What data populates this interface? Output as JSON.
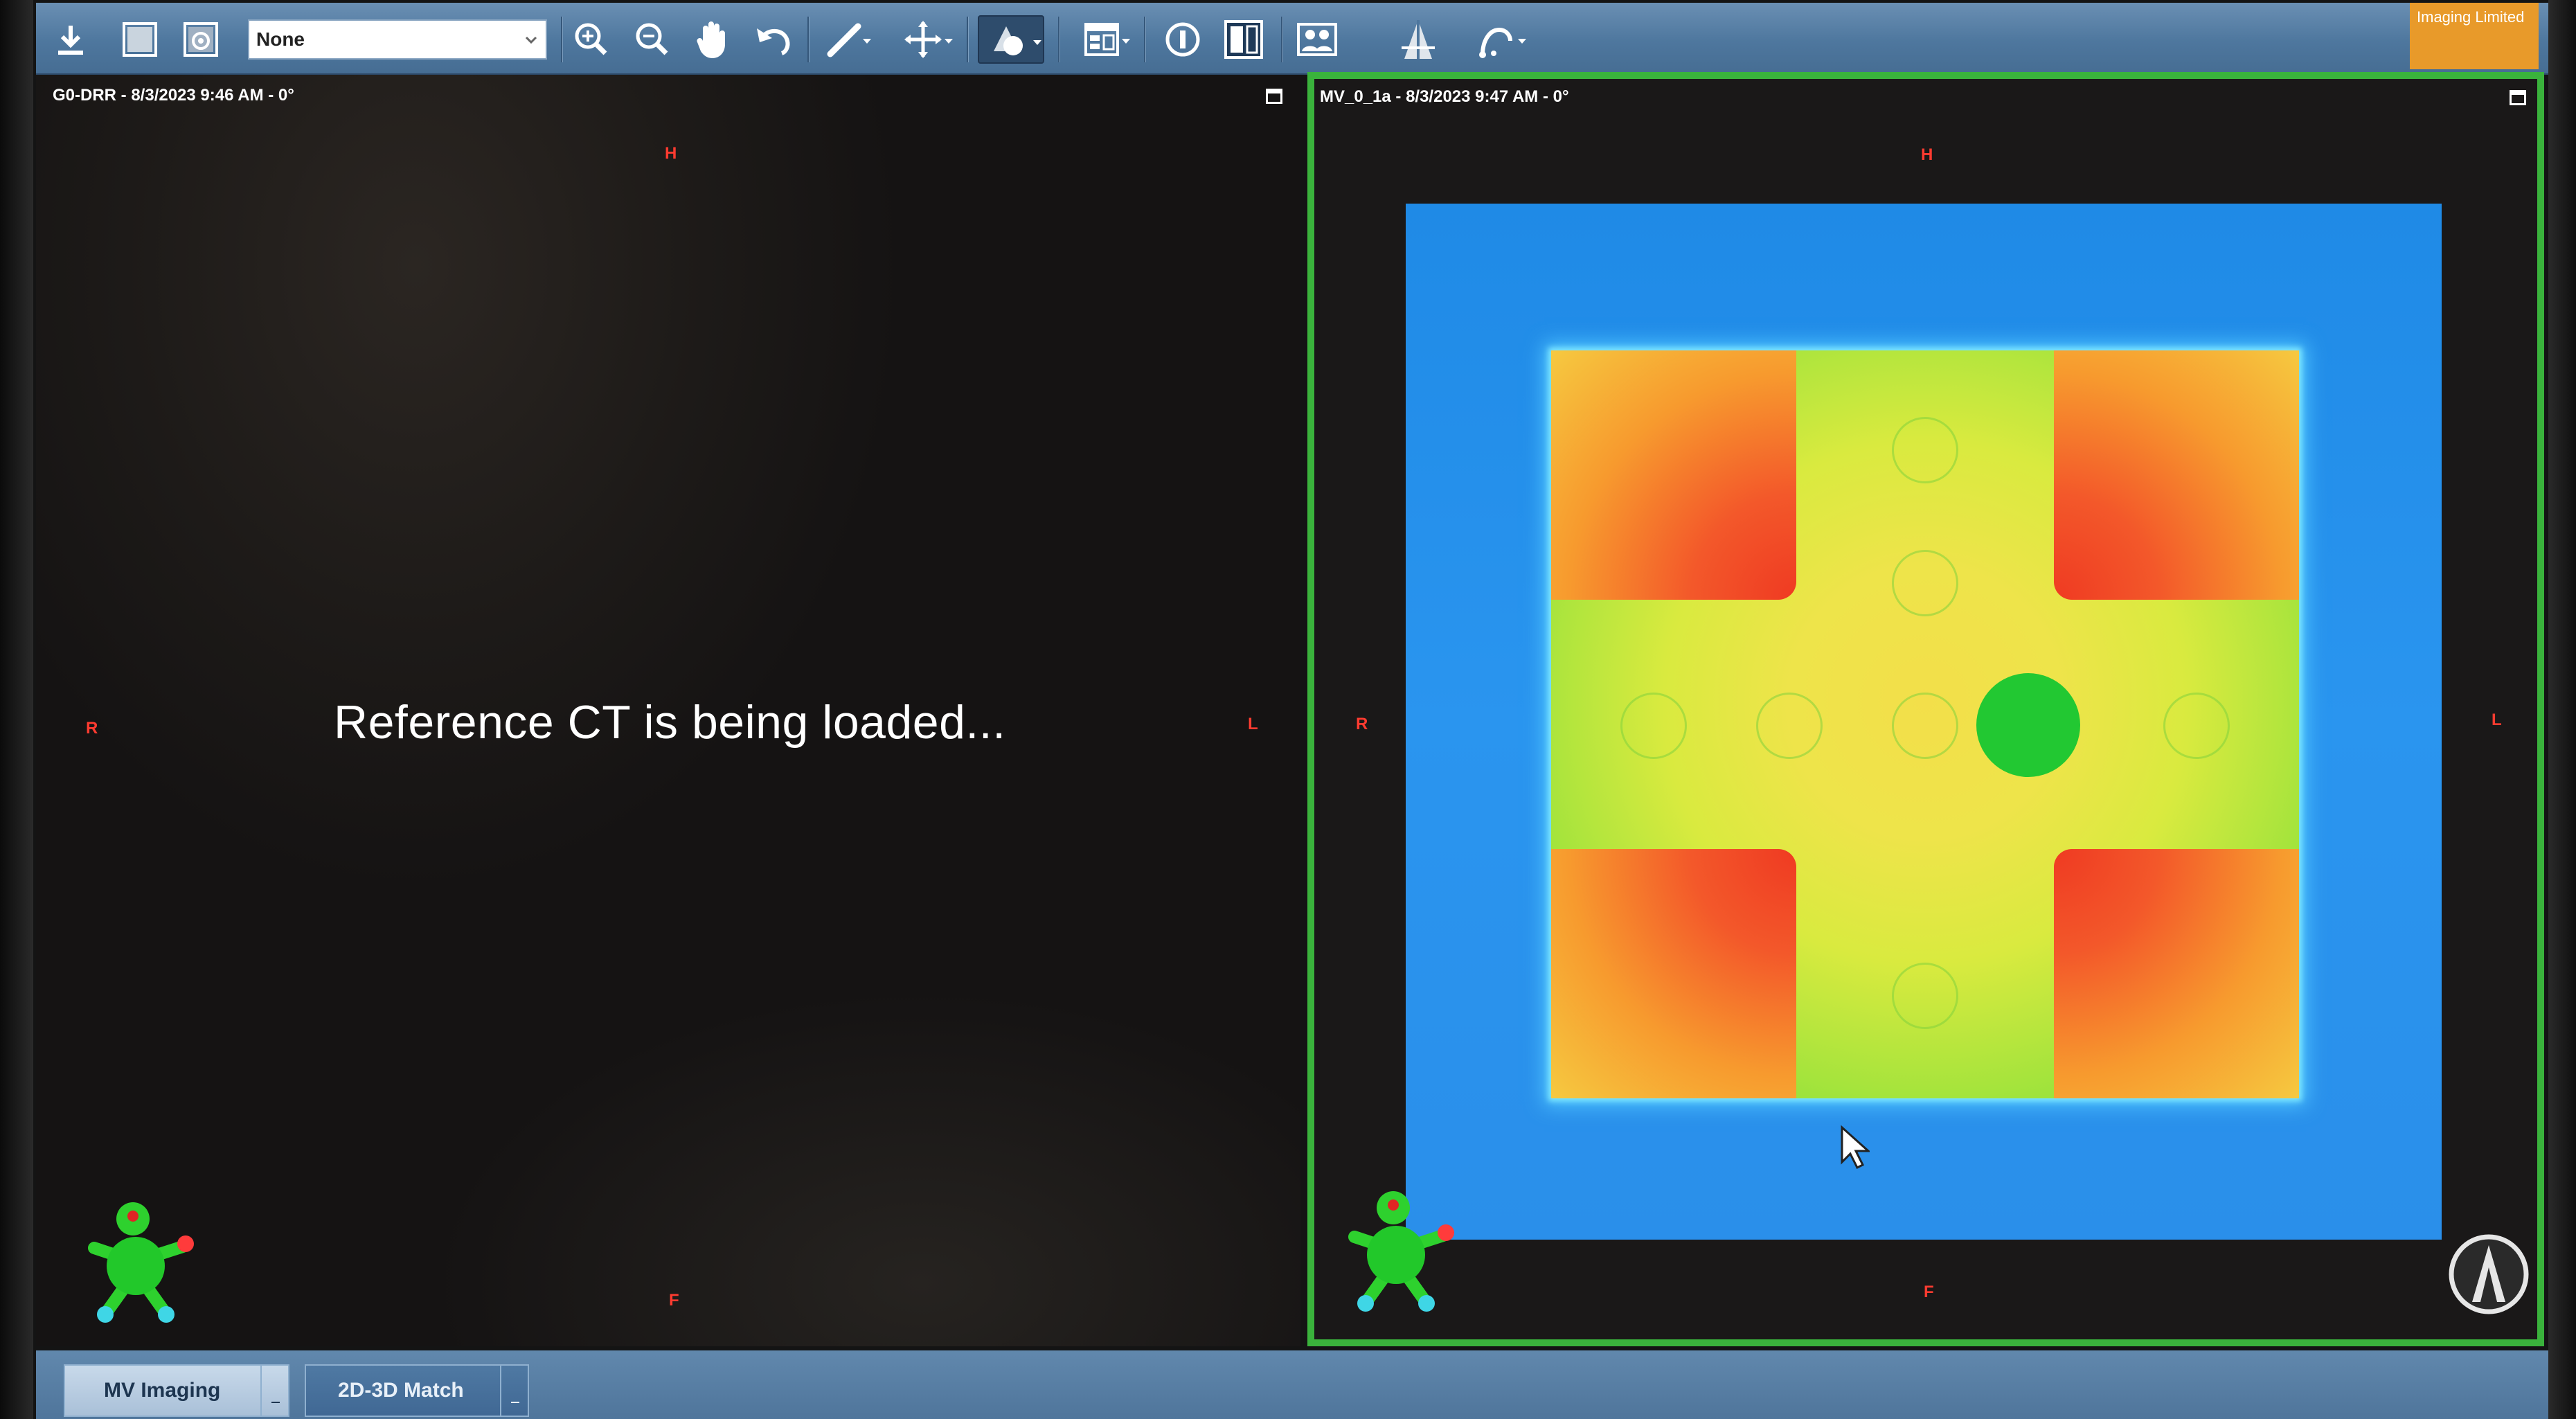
{
  "toolbar": {
    "preset_dropdown_value": "None",
    "badge_text": "Imaging Limited",
    "icons": [
      "download-icon",
      "image-icon",
      "image-settings-icon",
      "zoom-in-icon",
      "zoom-out-icon",
      "pan-hand-icon",
      "undo-icon",
      "measure-ruler-icon",
      "move-crosshair-icon",
      "overlay-shape-icon",
      "layout-icon",
      "info-icon",
      "split-view-icon",
      "patient-icons-icon",
      "beam-icon",
      "match-tool-icon"
    ]
  },
  "left_view": {
    "title": "G0-DRR - 8/3/2023 9:46 AM - 0°",
    "message": "Reference CT is being loaded...",
    "orientation": {
      "top": "H",
      "left": "R",
      "right": "L",
      "bottom": "F"
    }
  },
  "right_view": {
    "title": "MV_0_1a - 8/3/2023 9:47 AM - 0°",
    "orientation": {
      "top": "H",
      "left": "R",
      "right": "L",
      "bottom": "F"
    }
  },
  "bottom_tabs": [
    {
      "label": "MV Imaging",
      "active": true
    },
    {
      "label": "2D-3D Match",
      "active": false
    }
  ],
  "colors": {
    "active_view_border": "#3ab33c",
    "toolbar": "#5a82a8",
    "orientation_label": "#ff3b30",
    "badge": "#e89a2a"
  }
}
